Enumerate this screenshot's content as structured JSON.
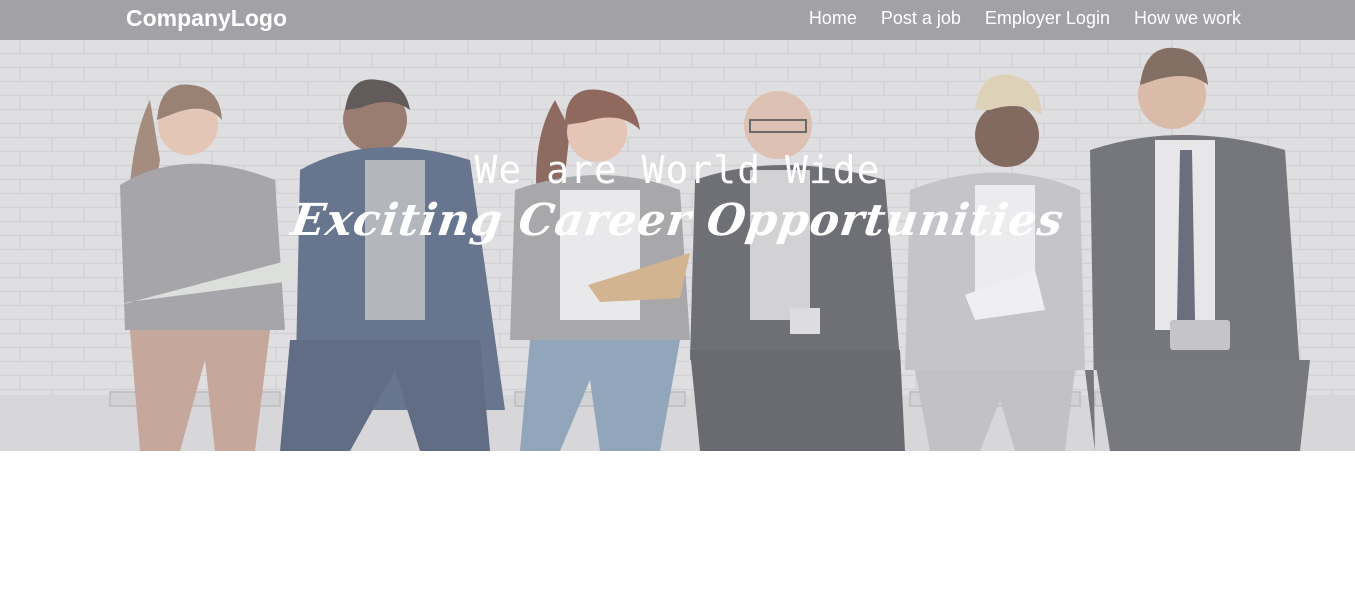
{
  "brand": {
    "logo_text": "CompanyLogo"
  },
  "nav": {
    "items": [
      {
        "label": "Home"
      },
      {
        "label": "Post a job"
      },
      {
        "label": "Employer Login"
      },
      {
        "label": "How we work"
      }
    ]
  },
  "hero": {
    "headline": "We are World Wide",
    "tagline": "Exciting Career Opportunities"
  },
  "colors": {
    "navbar": "#a2a2a6",
    "hero_text": "#ffffff"
  }
}
